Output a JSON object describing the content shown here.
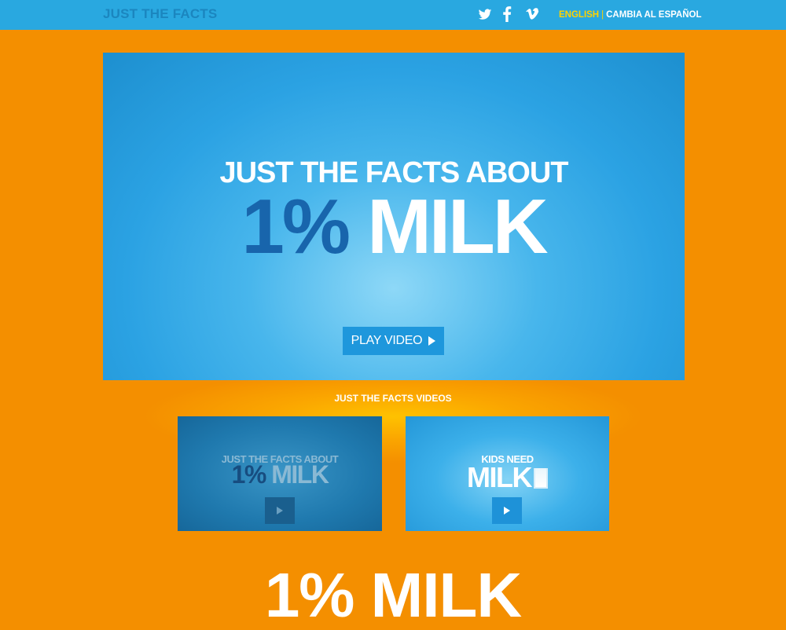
{
  "header": {
    "brand": "JUST THE FACTS",
    "social": [
      "twitter-icon",
      "facebook-icon",
      "vimeo-icon"
    ],
    "lang_active": "ENGLISH",
    "lang_separator": "|",
    "lang_other": "CAMBIA AL ESPAÑOL"
  },
  "hero": {
    "line1": "JUST THE FACTS ABOUT",
    "line2_percent": "1%",
    "line2_word": "MILK",
    "play_label": "PLAY VIDEO"
  },
  "videos": {
    "heading": "JUST THE FACTS VIDEOS",
    "items": [
      {
        "line1": "JUST THE FACTS ABOUT",
        "line2_percent": "1%",
        "line2_word": "MILK"
      },
      {
        "line1": "KIDS NEED",
        "line2_word": "MILK"
      }
    ]
  },
  "main": {
    "title": "1% MILK"
  },
  "colors": {
    "background": "#f48f00",
    "topbar": "#29a8e0",
    "accent_yellow": "#ffd200",
    "hero_blue": "#2ba2e3",
    "dark_blue": "#1865ac"
  }
}
